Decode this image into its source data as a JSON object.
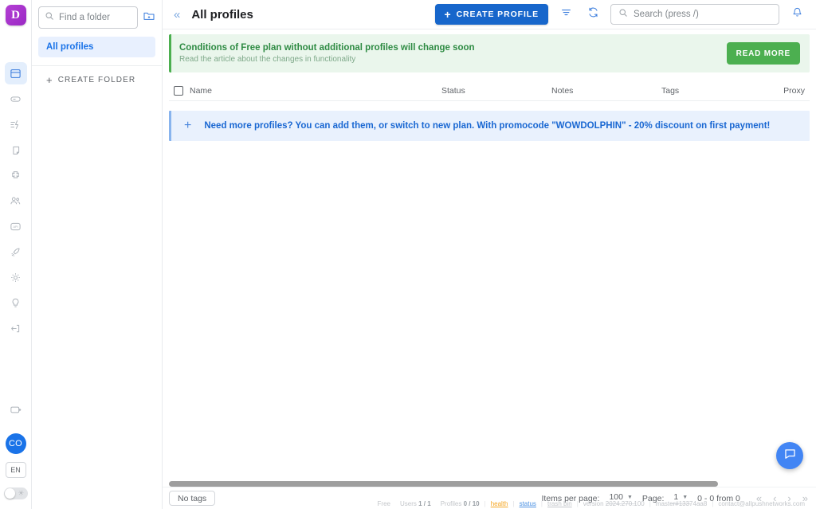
{
  "brand": {
    "logo_letter": "D",
    "logo_color": "#a72fc9"
  },
  "rail": {
    "items": [
      {
        "name": "browser-profiles-icon",
        "label": "Browser profiles",
        "active": true
      },
      {
        "name": "proxy-icon",
        "label": "Proxies",
        "active": false
      },
      {
        "name": "automation-icon",
        "label": "Automation",
        "active": false
      },
      {
        "name": "extensions-icon",
        "label": "Extensions",
        "active": false
      },
      {
        "name": "puzzle-icon",
        "label": "Plugins",
        "active": false
      },
      {
        "name": "team-icon",
        "label": "Team",
        "active": false
      },
      {
        "name": "api-icon",
        "label": "API",
        "active": false
      },
      {
        "name": "rocket-icon",
        "label": "Quick start",
        "active": false
      },
      {
        "name": "gear-icon",
        "label": "Settings",
        "active": false
      },
      {
        "name": "bulb-icon",
        "label": "Tips",
        "active": false
      },
      {
        "name": "logout-icon",
        "label": "Log out",
        "active": false
      }
    ],
    "bottom": {
      "export_icon": "export-icon",
      "avatar_initials": "CO",
      "language": "EN",
      "theme_toggle_state": "off"
    }
  },
  "folders": {
    "search_placeholder": "Find a folder",
    "search_value": "",
    "new_folder_icon": "new-folder-icon",
    "items": [
      {
        "label": "All profiles",
        "selected": true
      }
    ],
    "create_folder_label": "CREATE FOLDER"
  },
  "topbar": {
    "collapse_icon": "chevrons-left-icon",
    "title": "All profiles",
    "create_profile_label": "CREATE PROFILE",
    "filter_icon": "filter-icon",
    "refresh_icon": "refresh-icon",
    "search_placeholder": "Search (press /)",
    "search_value": "",
    "notifications_icon": "bell-icon",
    "accent_color": "#1766cb"
  },
  "banner": {
    "title": "Conditions of Free plan without additional profiles will change soon",
    "subtitle": "Read the article about the changes in functionality",
    "button_label": "READ MORE",
    "accent_color": "#4caf50",
    "background_color": "#eaf6ec"
  },
  "table": {
    "select_all_checked": false,
    "columns": [
      "Name",
      "Status",
      "Notes",
      "Tags",
      "Proxy"
    ],
    "rows": [],
    "promo": {
      "icon": "plus-icon",
      "text": "Need more profiles? You can add them, or switch to new plan. With promocode \"WOWDOLPHIN\" - 20% discount on first payment!",
      "color": "#1967d2"
    }
  },
  "bottombar": {
    "tags_filter_label": "No tags",
    "items_per_page_label": "Items per page:",
    "items_per_page_value": "100",
    "page_label": "Page:",
    "page_value": "1",
    "range_label": "0 - 0 from 0",
    "nav": {
      "first": "«",
      "prev": "‹",
      "next": "›",
      "last": "»"
    }
  },
  "footer": {
    "plan": "Free",
    "users_label": "Users",
    "users_value": "1 / 1",
    "profiles_label": "Profiles",
    "profiles_value": "0 / 10",
    "health_link": "health",
    "status_link": "status",
    "trash_link": "trash bin",
    "version": "version 2024.270.100",
    "build": "master#13374aa8",
    "contact": "contact@allpushnetworks.com"
  },
  "chat": {
    "icon": "chat-bubble-icon",
    "color": "#4285f4"
  }
}
